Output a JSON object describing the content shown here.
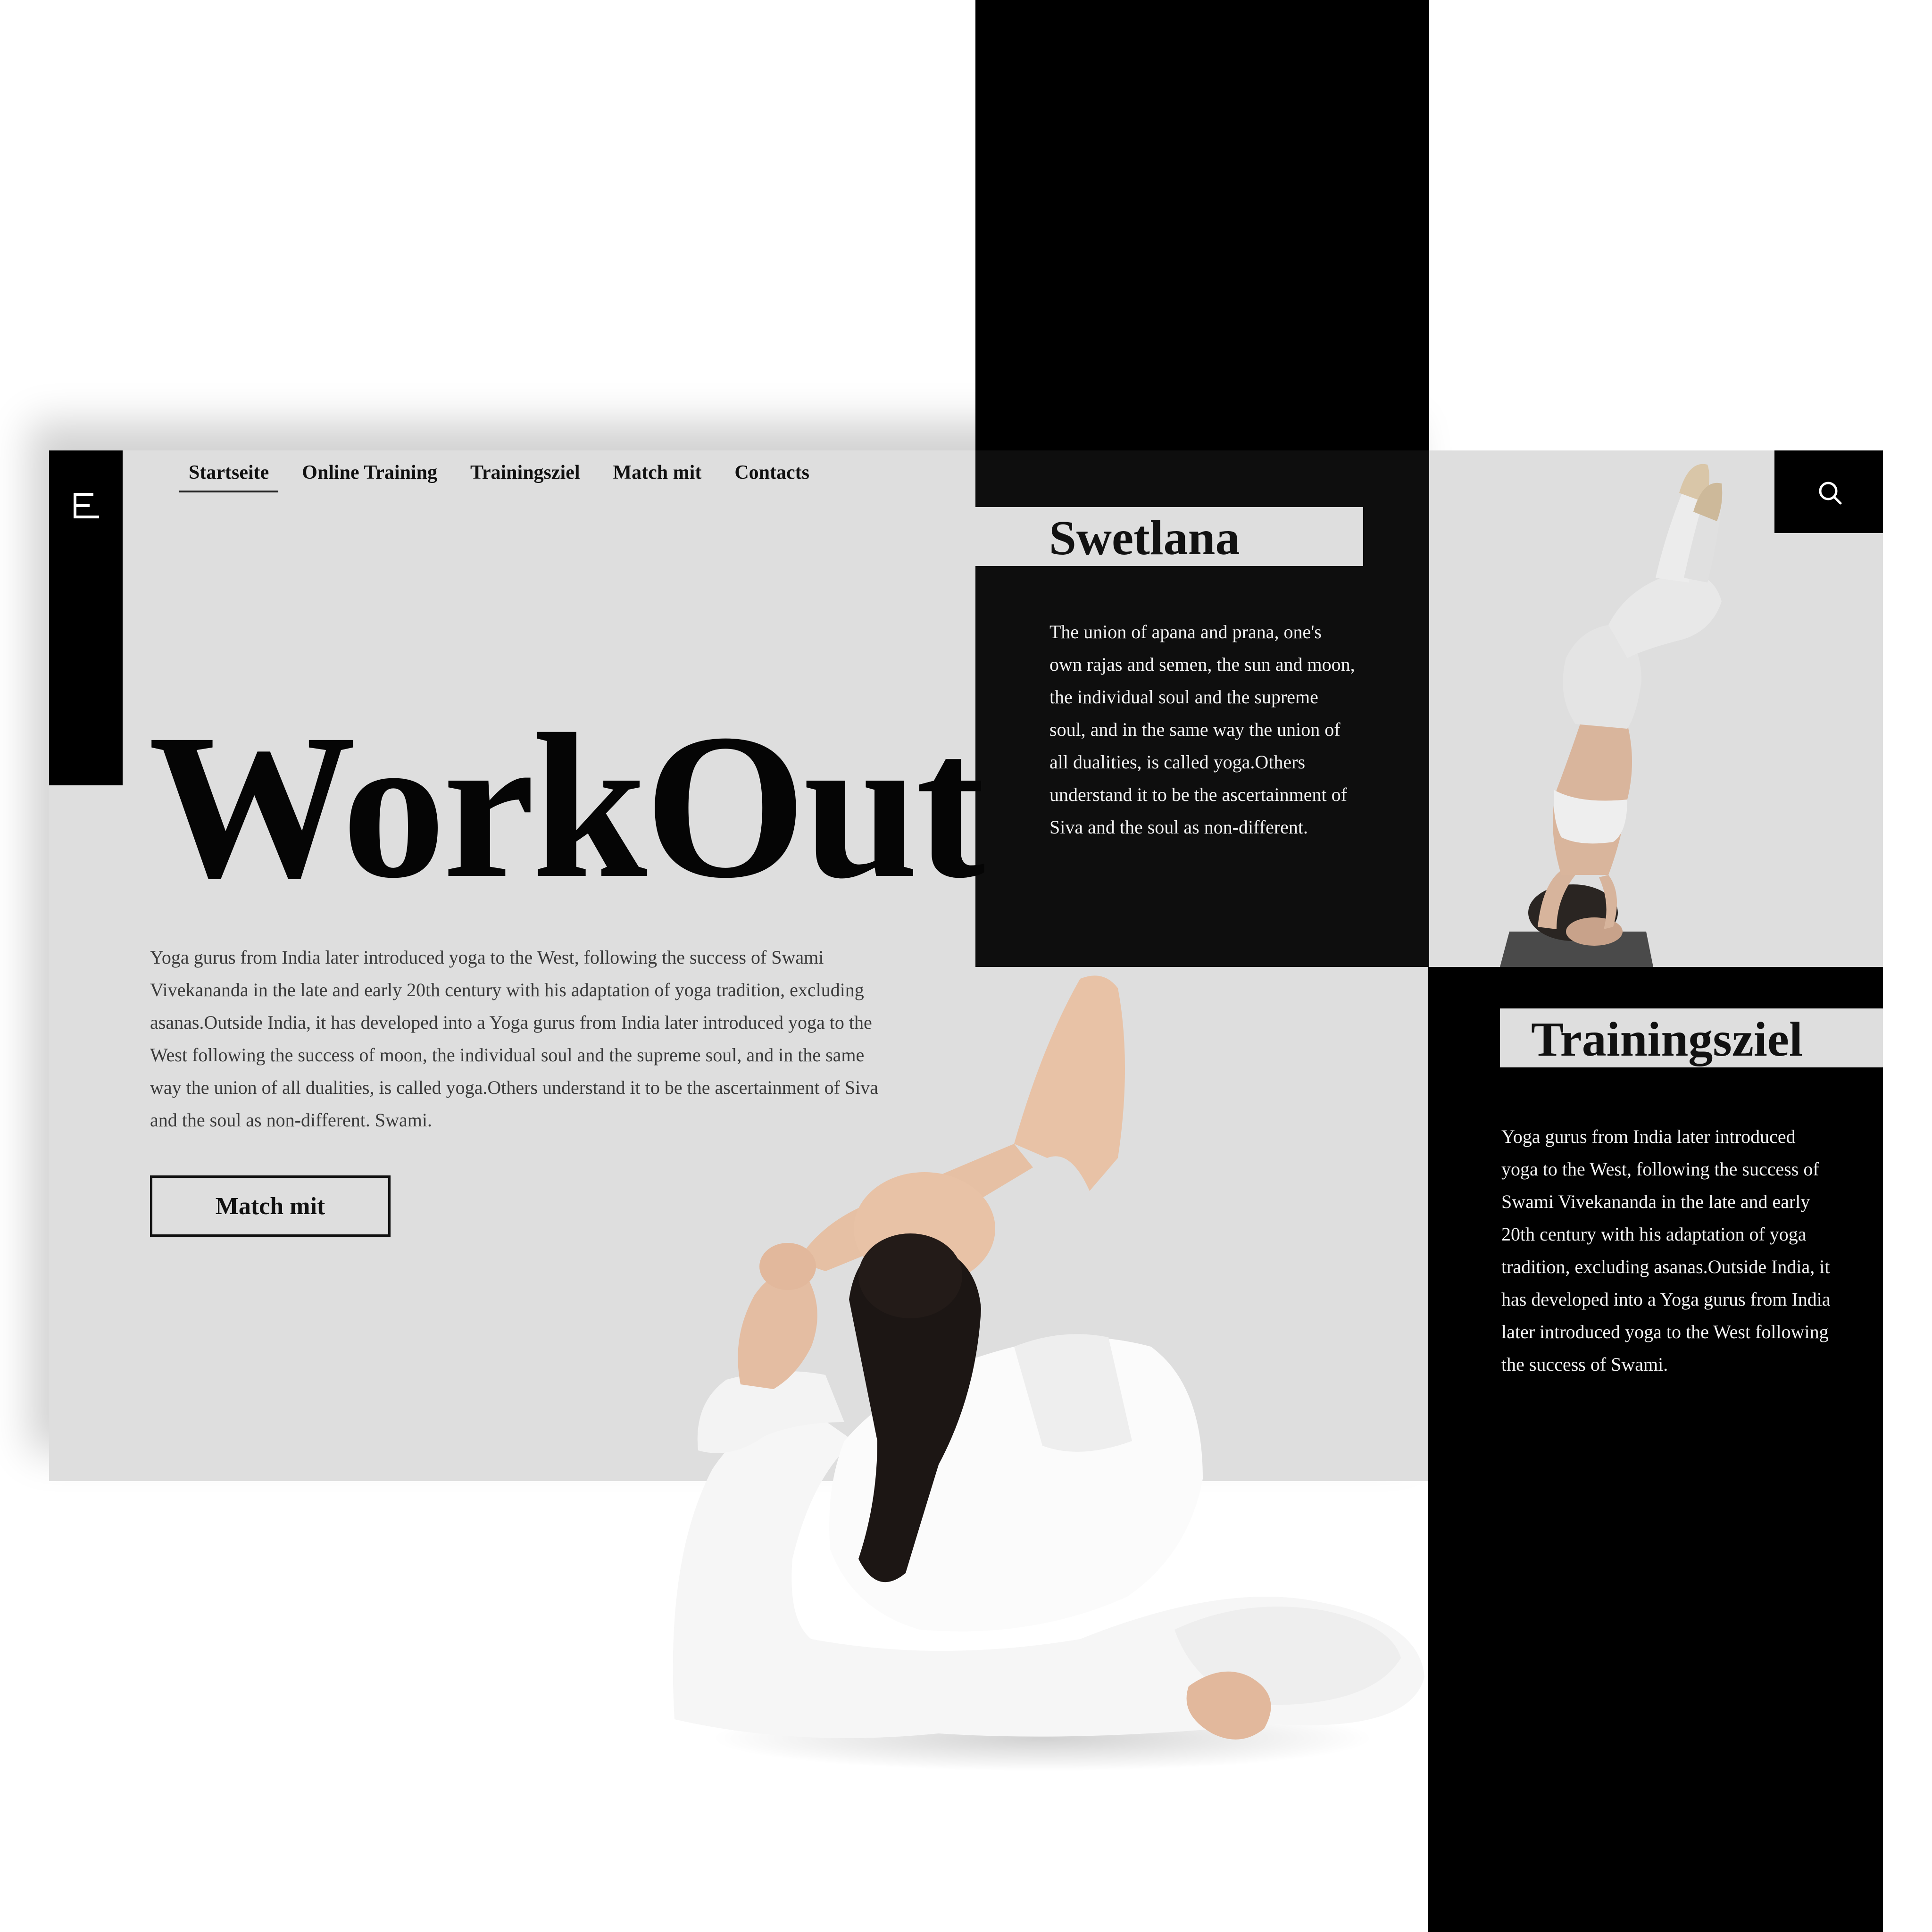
{
  "nav": {
    "items": [
      {
        "label": "Startseite",
        "active": true
      },
      {
        "label": "Online Training",
        "active": false
      },
      {
        "label": "Trainingsziel",
        "active": false
      },
      {
        "label": "Match mit",
        "active": false
      },
      {
        "label": "Contacts",
        "active": false
      }
    ]
  },
  "hero": {
    "title": "WorkOut",
    "text": "Yoga gurus from India later introduced yoga to the West, following the success of Swami Vivekananda in the late and early 20th century with his adaptation of yoga tradition, excluding asanas.Outside India, it has developed into a Yoga gurus from India later introduced yoga to the West following the success of moon, the individual soul and the supreme soul, and in the same way the union of all dualities, is called yoga.Others understand it to be the ascertainment of Siva and the soul as non-different. Swami.",
    "button_label": "Match mit"
  },
  "swetlana": {
    "title": "Swetlana",
    "text": "The union of apana and prana, one's own rajas and semen, the sun and moon, the individual soul and the supreme soul, and in the same way the union of all dualities, is called yoga.Others understand it to be the ascertainment of Siva and the soul as non-different."
  },
  "trainingsziel": {
    "title": "Trainingsziel",
    "text": "Yoga gurus from India later introduced yoga to the West, following the success of Swami Vivekananda in the late and early 20th century with his adaptation of yoga tradition, excluding asanas.Outside India, it has developed into a Yoga gurus from India later introduced yoga to the West following the success of Swami."
  },
  "icons": {
    "menu": "menu-icon",
    "search": "search-icon"
  },
  "colors": {
    "panel": "#dedede",
    "dark": "#000000",
    "card_dark": "#0e0e0e",
    "text_light": "#f2f2f2",
    "text_body": "#3a3a3a"
  }
}
